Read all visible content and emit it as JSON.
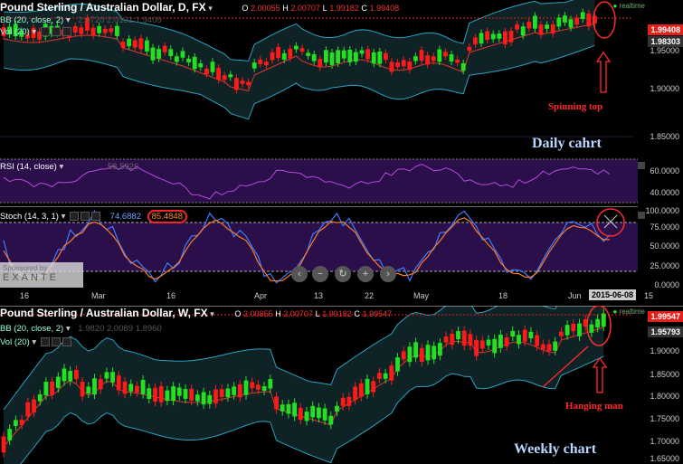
{
  "daily": {
    "title": "Pound Sterling / Australian Dollar, D, FX",
    "ohlc": {
      "o_label": "O",
      "o": "2.00055",
      "h_label": "H",
      "h": "2.00707",
      "l_label": "L",
      "l": "1.99182",
      "c_label": "C",
      "c": "1.99408"
    },
    "bb_label": "BB (20, close, 2)",
    "bb_values": "2.0720  2.0131  1.9409",
    "vol_label": "Vol (20)",
    "realtime": "realtime",
    "price_current": "1.99408",
    "price_second": "1.98303",
    "axis": [
      "1.95000",
      "1.90000",
      "1.85000"
    ],
    "annotation": "Spinning top",
    "chart_name": "Daily cahrt"
  },
  "rsi": {
    "label": "RSI (14, close)",
    "value": "58.5926",
    "axis": [
      "60.0000",
      "40.0000"
    ]
  },
  "stoch": {
    "label": "Stoch (14, 3, 1)",
    "value1": "74.6882",
    "value2": "85.4848",
    "axis": [
      "100.0000",
      "75.0000",
      "50.0000",
      "25.0000",
      "0.0000"
    ],
    "sponsor": "Sponsored by",
    "sponsor_brand": "EXANTE"
  },
  "date_axis": [
    "16",
    "Mar",
    "16",
    "Apr",
    "13",
    "22",
    "May",
    "18",
    "Jun",
    "2015-06-08",
    "15"
  ],
  "weekly": {
    "title": "Pound Sterling / Australian Dollar, W, FX",
    "ohlc": {
      "o_label": "O",
      "o": "2.00855",
      "h_label": "H",
      "h": "2.00707",
      "l_label": "L",
      "l": "1.99182",
      "c_label": "C",
      "c": "1.99547"
    },
    "bb_label": "BB (20, close, 2)",
    "bb_values": "1.9820  2.0089  1.8960",
    "vol_label": "Vol (20)",
    "realtime": "realtime",
    "price_current": "1.99547",
    "price_second": "1.95793",
    "axis": [
      "1.90000",
      "1.85000",
      "1.80000",
      "1.75000",
      "1.70000",
      "1.65000"
    ],
    "annotation": "Hanging man",
    "chart_name": "Weekly chart"
  },
  "colors": {
    "up": "#22e022",
    "down": "#ff1a1a",
    "band": "#2aa3bf",
    "mid": "#d8372f",
    "rsi": "#b74adb",
    "k": "#3d7cff",
    "d": "#ff7a2a",
    "purple": "#2a0f4a"
  }
}
